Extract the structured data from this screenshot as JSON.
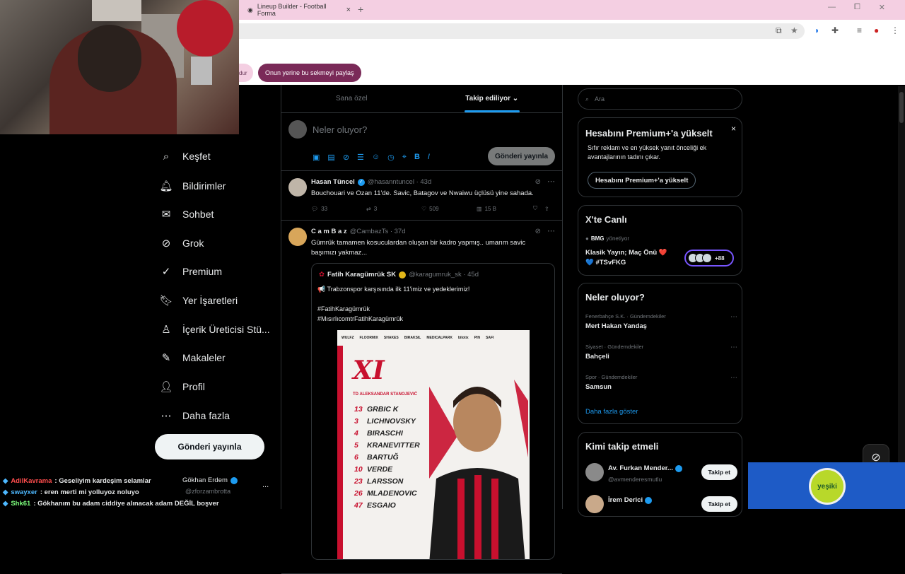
{
  "browser": {
    "tab_title": "Lineup Builder - Football Forma",
    "new_tab": "+",
    "win_min": "—",
    "win_max": "⧠",
    "win_close": "✕"
  },
  "banner": {
    "pill1": "dur",
    "pill2": "Onun yerine bu sekmeyi paylaş"
  },
  "nav": {
    "items": [
      {
        "icon": "search-icon",
        "glyph": "⌕",
        "label": "Keşfet"
      },
      {
        "icon": "bell-icon",
        "glyph": "🔔︎",
        "label": "Bildirimler"
      },
      {
        "icon": "mail-icon",
        "glyph": "✉",
        "label": "Sohbet"
      },
      {
        "icon": "grok-icon",
        "glyph": "⊘",
        "label": "Grok"
      },
      {
        "icon": "premium-icon",
        "glyph": "✓",
        "label": "Premium"
      },
      {
        "icon": "bookmark-icon",
        "glyph": "🔖︎",
        "label": "Yer İşaretleri"
      },
      {
        "icon": "creator-icon",
        "glyph": "♙",
        "label": "İçerik Üreticisi Stü..."
      },
      {
        "icon": "article-icon",
        "glyph": "✎",
        "label": "Makaleler"
      },
      {
        "icon": "profile-icon",
        "glyph": "👤︎",
        "label": "Profil"
      },
      {
        "icon": "more-icon",
        "glyph": "⋯",
        "label": "Daha fazla"
      }
    ],
    "post_button": "Gönderi yayınla",
    "account_name": "Gökhan Erdem",
    "account_handle": "@zforzambrotta",
    "account_more": "..."
  },
  "chat": [
    {
      "user": "AdilKavrama",
      "color": "#ff4d4d",
      "text": ": Geseliyim kardeşim selamlar"
    },
    {
      "user": "swayxer",
      "color": "#4db8ff",
      "text": ": eren merti mi yolluyoz noluyo"
    },
    {
      "user": "Shk61",
      "color": "#7dff7d",
      "text": ": Gökhanım bu adam ciddiye alınacak adam DEĞİL boşver"
    }
  ],
  "feed": {
    "tabs": [
      "Sana özel",
      "Takip ediliyor ⌄"
    ],
    "compose_placeholder": "Neler oluyor?",
    "compose_button": "Gönderi yayınla",
    "tweets": [
      {
        "name": "Hasan Tüncel",
        "handle": "@hasanntuncel · 43d",
        "text": "Bouchouari ve Ozan 11'de. Savic, Batagov ve Nwaiwu üçlüsü yine sahada.",
        "replies": "33",
        "reposts": "3",
        "likes": "509",
        "views": "15 B"
      },
      {
        "name": "C a m B a z",
        "handle": "@CambazTs · 37d",
        "text": "Gümrük tamamen kosuculardan oluşan bir kadro yapmış.. umarım savic başımızı yakmaz..."
      }
    ],
    "quote": {
      "name": "Fatih Karagümrük SK",
      "handle": "@karagumruk_sk · 45d",
      "text": "📢 Trabzonspor karşısında ilk 11'imiz ve yedeklerimiz!\n\n#FatihKaragümrük\n#MısırlıcomtrFatihKaragümrük"
    },
    "lineup": {
      "sponsors": [
        "WULFZ",
        "FLOORMIX",
        "SHAKES",
        "BIRAKSIL",
        "MEDICALPARK",
        "bilotix",
        "PIN",
        "SAFI"
      ],
      "title": "XI",
      "coach": "TD ALEKSANDAR STANOJEVIĆ",
      "players": [
        {
          "no": "13",
          "name": "GRBIC K"
        },
        {
          "no": "3",
          "name": "LICHNOVSKY"
        },
        {
          "no": "4",
          "name": "BIRASCHI"
        },
        {
          "no": "5",
          "name": "KRANEVITTER"
        },
        {
          "no": "6",
          "name": "BARTUĞ"
        },
        {
          "no": "10",
          "name": "VERDE"
        },
        {
          "no": "23",
          "name": "LARSSON"
        },
        {
          "no": "26",
          "name": "MLADENOVIC"
        },
        {
          "no": "47",
          "name": "ESGAIO"
        }
      ]
    }
  },
  "right": {
    "search_placeholder": "Ara",
    "premium": {
      "title": "Hesabını Premium+'a yükselt",
      "desc": "Sıfır reklam ve en yüksek yanıt önceliği ek avantajlarının tadını çıkar.",
      "button": "Hesabını Premium+'a yükselt",
      "close": "×"
    },
    "live": {
      "title": "X'te Canlı",
      "host": "BMG",
      "host_suffix": "yönetiyor",
      "event": "Klasik Yayın; Maç Önü ❤️ 💙 #TSvFKG",
      "count": "+88"
    },
    "trends": {
      "title": "Neler oluyor?",
      "items": [
        {
          "cat": "Fenerbahçe S.K. · Gündemdekiler",
          "name": "Mert Hakan Yandaş"
        },
        {
          "cat": "Siyaset · Gündemdekiler",
          "name": "Bahçeli"
        },
        {
          "cat": "Spor · Gündemdekiler",
          "name": "Samsun"
        }
      ],
      "more": "Daha fazla göster"
    },
    "who": {
      "title": "Kimi takip etmeli",
      "users": [
        {
          "name": "Av. Furkan Mender...",
          "handle": "@avmenderesmutlu",
          "button": "Takip et"
        },
        {
          "name": "İrem Derici",
          "handle": "",
          "button": "Takip et"
        }
      ]
    }
  },
  "ad": {
    "logo": "yeşiki"
  }
}
